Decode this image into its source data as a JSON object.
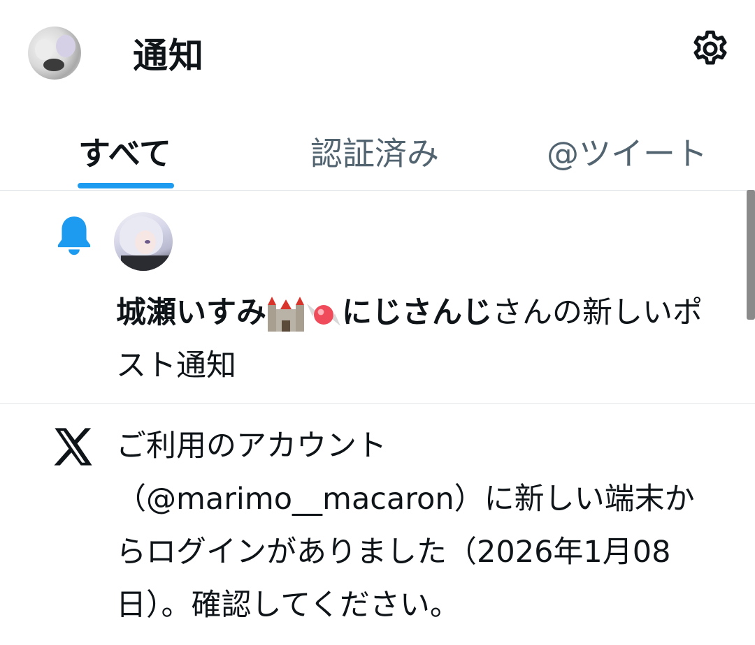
{
  "header": {
    "title": "通知"
  },
  "tabs": [
    {
      "label": "すべて",
      "active": true
    },
    {
      "label": "認証済み",
      "active": false
    },
    {
      "label": "@ツイート",
      "active": false
    }
  ],
  "notifications": [
    {
      "type": "new_post",
      "icon": "bell-icon",
      "icon_color": "#1d9bf0",
      "user_name": "城瀬いすみ",
      "user_name_affiliation": "にじさんじ",
      "emojis": [
        "castle-emoji",
        "candy-emoji"
      ],
      "text": "さんの新しいポスト通知"
    },
    {
      "type": "security",
      "icon": "x-logo-icon",
      "text": "ご利用のアカウント（@marimo__macaron）に新しい端末からログインがありました（2026年1月08日）。確認してください。"
    }
  ],
  "colors": {
    "accent": "#1d9bf0",
    "text_primary": "#0f1419",
    "text_secondary": "#536471",
    "divider": "#e3e6e9"
  }
}
